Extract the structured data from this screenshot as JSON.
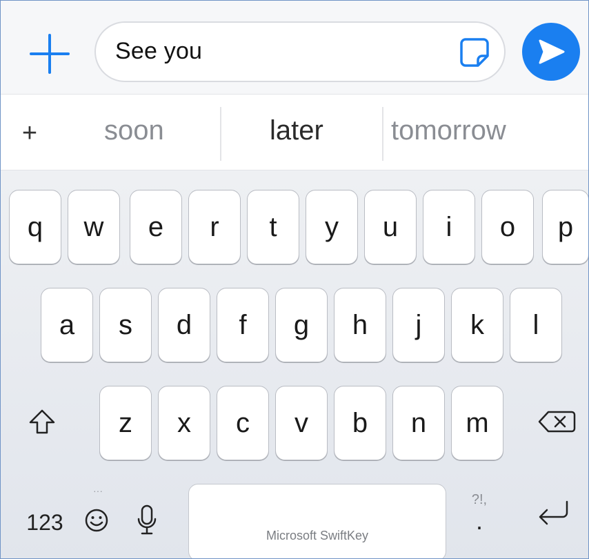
{
  "compose": {
    "input_value": "See you",
    "add_icon": "plus-icon",
    "sticker_icon": "sticker-icon",
    "send_icon": "send-icon",
    "accent_color": "#1a7ff0"
  },
  "suggestions": {
    "plus": "+",
    "items": [
      "soon",
      "later",
      "tomorrow"
    ]
  },
  "keyboard": {
    "row1": [
      "q",
      "w",
      "e",
      "r",
      "t",
      "y",
      "u",
      "i",
      "o",
      "p"
    ],
    "row2": [
      "a",
      "s",
      "d",
      "f",
      "g",
      "h",
      "j",
      "k",
      "l"
    ],
    "row3": [
      "z",
      "x",
      "c",
      "v",
      "b",
      "n",
      "m"
    ],
    "numbers_key": "123",
    "emoji_dots": "···",
    "punct_hint": "?!,",
    "punct_main": ".",
    "space_label": "Microsoft SwiftKey",
    "shift_icon": "shift-icon",
    "backspace_icon": "backspace-icon",
    "mic_icon": "microphone-icon",
    "emoji_icon": "emoji-icon",
    "return_icon": "return-icon"
  }
}
